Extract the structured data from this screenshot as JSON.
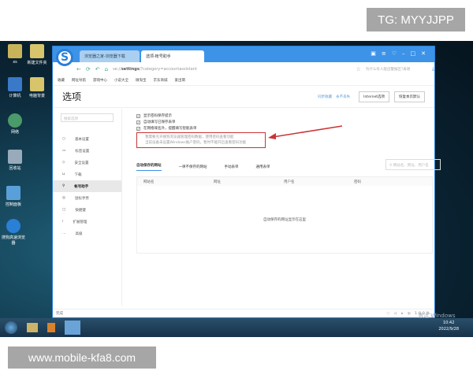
{
  "overlay": {
    "tg": "TG: MYYJJPP",
    "site": "www.mobile-kfa8.com"
  },
  "desktop": {
    "icons": [
      "xs",
      "新建文件夹",
      "计算机",
      "电脑背景",
      "网络",
      "回收站",
      "控制面板",
      "搜狗高速浏览器"
    ]
  },
  "browser": {
    "tabs": [
      {
        "label": "浏览器之家-浏览器下载"
      },
      {
        "label": "选项-帐号助手"
      }
    ],
    "url_prefix": "se://",
    "url_bold": "settings",
    "url_rest": "/?category=accountassistant",
    "search_placeholder": "为什么有人能出警报区?再谢",
    "bookmarks": [
      "收藏",
      "网址导航",
      "游戏中心",
      "小说大全",
      "微淘宝",
      "京东商城",
      "爱出萌"
    ]
  },
  "page": {
    "title": "选项",
    "sync_link": "同步收藏",
    "sync_link2": "永不丢失",
    "btn_internet": "Internet选项",
    "btn_restore": "恢复本页默认",
    "sidebar_search": "搜索选项",
    "sidebar": [
      {
        "label": "基本设置",
        "icon": "○"
      },
      {
        "label": "标签设置",
        "icon": "▭"
      },
      {
        "label": "安全设置",
        "icon": "◇"
      },
      {
        "label": "下载",
        "icon": "⊔"
      },
      {
        "label": "帐号助手",
        "icon": "⚲"
      },
      {
        "label": "鼠标手势",
        "icon": "◎"
      },
      {
        "label": "快捷键",
        "icon": "▢"
      },
      {
        "label": "扩展管理",
        "icon": "⁞"
      },
      {
        "label": "高级",
        "icon": "…"
      }
    ],
    "active_sidebar": "帐号助手",
    "checks": [
      {
        "label": "显示密码保存提示",
        "checked": true
      },
      {
        "label": "自动填写已保存表单",
        "checked": true
      },
      {
        "label": "在网络域名外，提醒填写智能表单",
        "checked": true
      }
    ],
    "notice_line1": "我需要允许搜狗浏览器管理密码数据，使用密码查看功能",
    "notice_line2": "当前设备未设置Windows账户密码，暂时不能开启查看密码功能",
    "tabs": [
      "自动保存的网站",
      "一律不保存的网站",
      "手动表单",
      "通用表单"
    ],
    "table_search": "网站名、网址、用户名",
    "columns": [
      "网站名",
      "网址",
      "用户名",
      "密码"
    ],
    "empty": "自动保存的网址显示在这里",
    "status": "完成",
    "zoom": "100%"
  },
  "taskbar": {
    "time": "10:42",
    "date": "2022/9/28",
    "activate": "激活 Windows"
  },
  "colors": {
    "accent": "#3d93e8",
    "highlight": "#cc3333"
  }
}
